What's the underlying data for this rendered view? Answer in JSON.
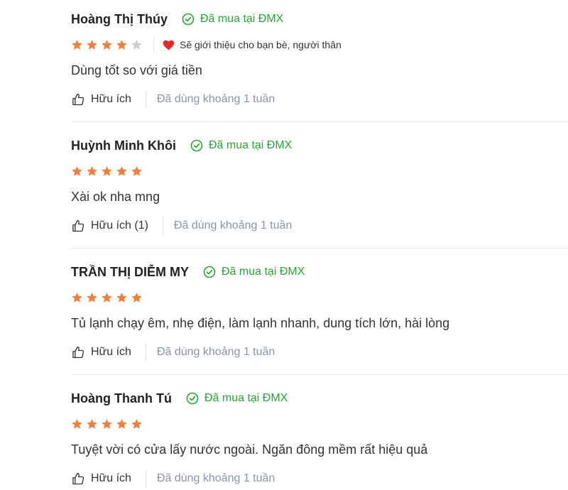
{
  "colors": {
    "star_filled": "#f0803c",
    "star_empty": "#cfcfcf",
    "verified": "#2ba336",
    "heart": "#e02b2b",
    "muted": "#8a94a6"
  },
  "icons": {
    "verified": "check-circle-icon",
    "helpful": "thumbs-up-icon",
    "recommend": "heart-icon",
    "star": "star-icon"
  },
  "reviews": [
    {
      "name": "Hoàng Thị Thúy",
      "verified_label": "Đã mua tại ĐMX",
      "rating": 4,
      "max_rating": 5,
      "recommend_label": "Sẽ giới thiệu cho bạn bè, người thân",
      "content": "Dùng tốt so với giá tiền",
      "helpful_label": "Hữu ích",
      "usage_label": "Đã dùng khoảng 1 tuần"
    },
    {
      "name": "Huỳnh Minh Khôi",
      "verified_label": "Đã mua tại ĐMX",
      "rating": 5,
      "max_rating": 5,
      "content": "Xài ok nha mng",
      "helpful_label": "Hữu ích (1)",
      "usage_label": "Đã dùng khoảng 1 tuần"
    },
    {
      "name": "TRẦN THỊ DIỄM MY",
      "verified_label": "Đã mua tại ĐMX",
      "rating": 5,
      "max_rating": 5,
      "content": "Tủ lạnh chạy êm, nhẹ điện, làm lạnh nhanh, dung tích lớn, hài lòng",
      "helpful_label": "Hữu ích",
      "usage_label": "Đã dùng khoảng 1 tuần"
    },
    {
      "name": "Hoàng Thanh Tú",
      "verified_label": "Đã mua tại ĐMX",
      "rating": 5,
      "max_rating": 5,
      "content": "Tuyệt vời có cửa lấy nước ngoài. Ngăn đông mềm rất hiệu quả",
      "helpful_label": "Hữu ích",
      "usage_label": "Đã dùng khoảng 1 tuần"
    }
  ]
}
